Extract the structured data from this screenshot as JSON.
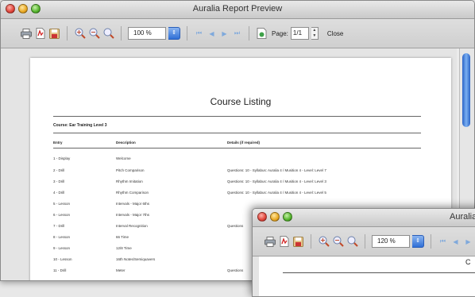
{
  "window": {
    "title": "Auralia Report Preview"
  },
  "toolbar": {
    "zoom_value": "100 %",
    "page_label": "Page:",
    "page_value": "1/1",
    "close_label": "Close"
  },
  "report": {
    "title": "Course Listing",
    "course": "Course: Ear Training Level 3",
    "columns": [
      "Entry",
      "Description",
      "Details (if required)"
    ],
    "rows": [
      [
        "1 - Display",
        "Welcome",
        ""
      ],
      [
        "2 - Drill",
        "Pitch Comparison",
        "Questions: 10 - Syllabus: Auralia 4 / Musition 4 - Level: Level 7"
      ],
      [
        "3 - Drill",
        "Rhythm Imitation",
        "Questions: 10 - Syllabus: Auralia 4 / Musition 4 - Level: Level 3"
      ],
      [
        "4 - Drill",
        "Rhythm Comparison",
        "Questions: 10 - Syllabus: Auralia 4 / Musition 4 - Level: Level 5"
      ],
      [
        "5 - Lesson",
        "Intervals - Major 6ths",
        ""
      ],
      [
        "6 - Lesson",
        "Intervals - Major 7ths",
        ""
      ],
      [
        "7 - Drill",
        "Interval Recognition",
        "Questions"
      ],
      [
        "8 - Lesson",
        "66 Time",
        ""
      ],
      [
        "9 - Lesson",
        "12/8 Time",
        ""
      ],
      [
        "10 - Lesson",
        "16th Notes/Semiquavers",
        ""
      ],
      [
        "11 - Drill",
        "Meter",
        "Questions"
      ]
    ]
  },
  "window2": {
    "title": "Auralia",
    "zoom_value": "120 %",
    "doc_title_fragment": "C"
  }
}
